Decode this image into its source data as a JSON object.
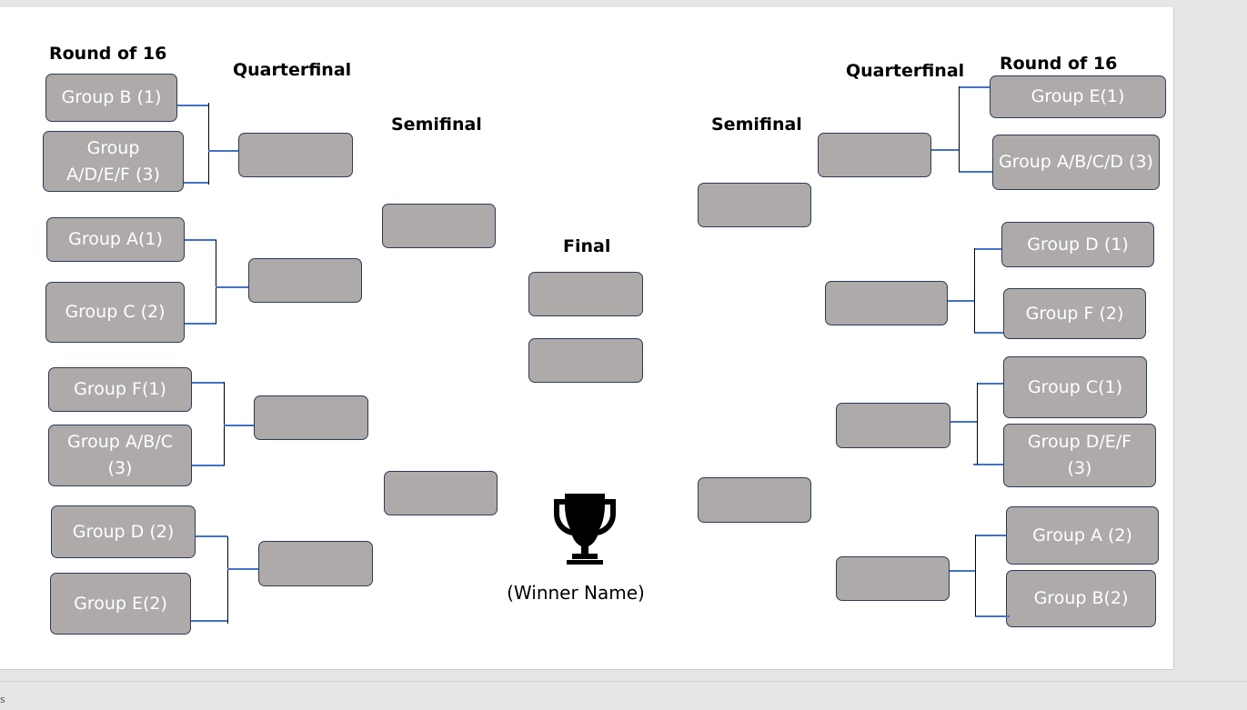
{
  "headers": {
    "left_r16": "Round of 16",
    "left_qf": "Quarterfinal",
    "left_sf": "Semifinal",
    "final": "Final",
    "right_sf": "Semifinal",
    "right_qf": "Quarterfinal",
    "right_r16": "Round of 16"
  },
  "left_r16": [
    "Group B (1)",
    "Group A/D/E/F (3)",
    "Group A(1)",
    "Group C (2)",
    "Group F(1)",
    "Group A/B/C (3)",
    "Group D (2)",
    "Group E(2)"
  ],
  "right_r16": [
    "Group E(1)",
    "Group A/B/C/D (3)",
    "Group D (1)",
    "Group F (2)",
    "Group C(1)",
    "Group D/E/F (3)",
    "Group A (2)",
    "Group B(2)"
  ],
  "winner": "(Winner Name)",
  "status_edge": "s",
  "colors": {
    "box_fill": "#aeaaaa",
    "box_border": "#2f3a56",
    "connector_blue": "#4472c4",
    "box_text": "#ffffff"
  },
  "icons": {
    "trophy": "trophy-icon"
  }
}
